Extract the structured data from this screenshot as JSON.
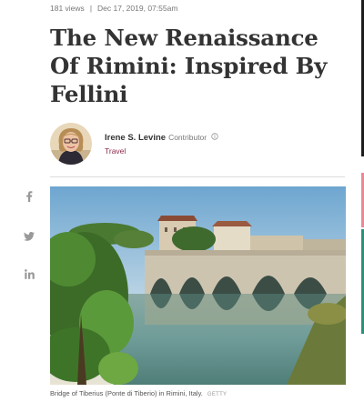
{
  "article": {
    "views": "181 views",
    "separator": "|",
    "date": "Dec 17, 2019, 07:55am",
    "title": "The New Renaissance Of Rimini: Inspired By Fellini"
  },
  "author": {
    "name": "Irene S. Levine",
    "role": "Contributor",
    "role_icon": "info-icon",
    "section": "Travel",
    "avatar_icon": "author-avatar"
  },
  "share": {
    "icons": [
      "facebook-icon",
      "twitter-icon",
      "linkedin-icon"
    ]
  },
  "hero": {
    "caption": "Bridge of Tiberius (Ponte di Tiberio) in Rimini, Italy.",
    "credit": "GETTY"
  },
  "colors": {
    "section_link": "#8c2a4a",
    "title_text": "#333333",
    "rail_dark": "#1d1d1d",
    "rail_pink": "#e88a95",
    "rail_green": "#2c8f7a"
  }
}
